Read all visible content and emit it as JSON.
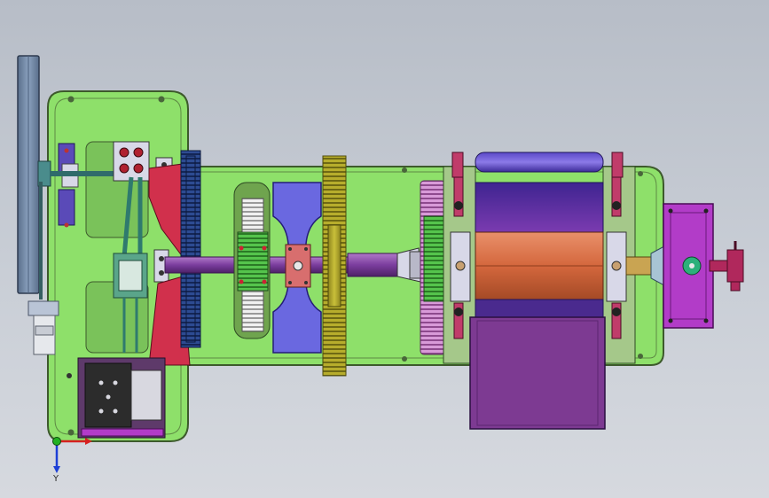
{
  "viewport": {
    "background_top": "#b7bdc7",
    "background_bottom": "#d6d9df"
  },
  "triad": {
    "y_axis_label": "Y",
    "x_color": "#d62020",
    "y_color": "#1d3fd6",
    "z_color": "#22b022"
  },
  "colors": {
    "frame": "#8ee06a",
    "frame_edge": "#3d5a2c",
    "flywheel": "#6f86a3",
    "gear_blue": "#26407e",
    "gear_yellow": "#b7ad2c",
    "gear_green": "#3fa53a",
    "gear_white": "#e8e8e8",
    "rotor_orange": "#d5683e",
    "housing_purple": "#6a2f86",
    "bracket_blue": "#5c5bd8",
    "motor_magenta": "#b23cc8",
    "crank_red": "#d1304c",
    "shaft_violet": "#7b3d9e",
    "cabinet_dark": "#2c2c2c"
  }
}
